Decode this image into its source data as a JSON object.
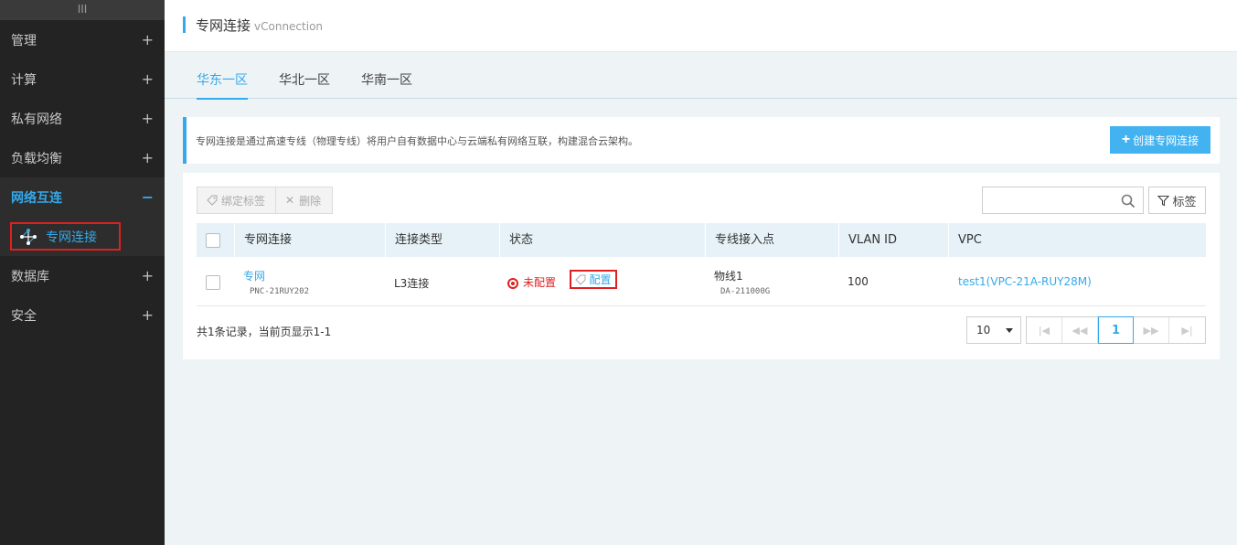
{
  "sidebar": {
    "toggle": "III",
    "items": [
      {
        "label": "管理",
        "icon": "+"
      },
      {
        "label": "计算",
        "icon": "+"
      },
      {
        "label": "私有网络",
        "icon": "+"
      },
      {
        "label": "负载均衡",
        "icon": "+"
      },
      {
        "label": "网络互连",
        "icon": "−"
      },
      {
        "label": "数据库",
        "icon": "+"
      },
      {
        "label": "安全",
        "icon": "+"
      }
    ],
    "sub_item": {
      "label": "专网连接",
      "icon": "network-topology-icon"
    }
  },
  "header": {
    "title": "专网连接",
    "subtitle": "vConnection"
  },
  "tabs": [
    {
      "label": "华东一区",
      "active": true
    },
    {
      "label": "华北一区",
      "active": false
    },
    {
      "label": "华南一区",
      "active": false
    }
  ],
  "info": {
    "text": "专网连接是通过高速专线（物理专线）将用户自有数据中心与云端私有网络互联，构建混合云架构。",
    "create_button": "创建专网连接"
  },
  "toolbar": {
    "bind_tag": "绑定标签",
    "delete": "删除",
    "tag_filter": "标签",
    "search_placeholder": ""
  },
  "table": {
    "headers": [
      "专网连接",
      "连接类型",
      "状态",
      "专线接入点",
      "VLAN ID",
      "VPC"
    ],
    "rows": [
      {
        "name": "专网",
        "id": "PNC-21RUY202",
        "type": "L3连接",
        "status": "未配置",
        "action": "配置",
        "access_point": "物线1",
        "access_point_id": "DA-211000G",
        "vlan_id": "100",
        "vpc": "test1(VPC-21A-RUY28M)"
      }
    ]
  },
  "footer": {
    "summary": "共1条记录，当前页显示1-1",
    "page_size": "10",
    "current_page": "1"
  },
  "colors": {
    "accent": "#35a9ea",
    "sidebar_bg": "#232323",
    "error": "#e02020"
  }
}
